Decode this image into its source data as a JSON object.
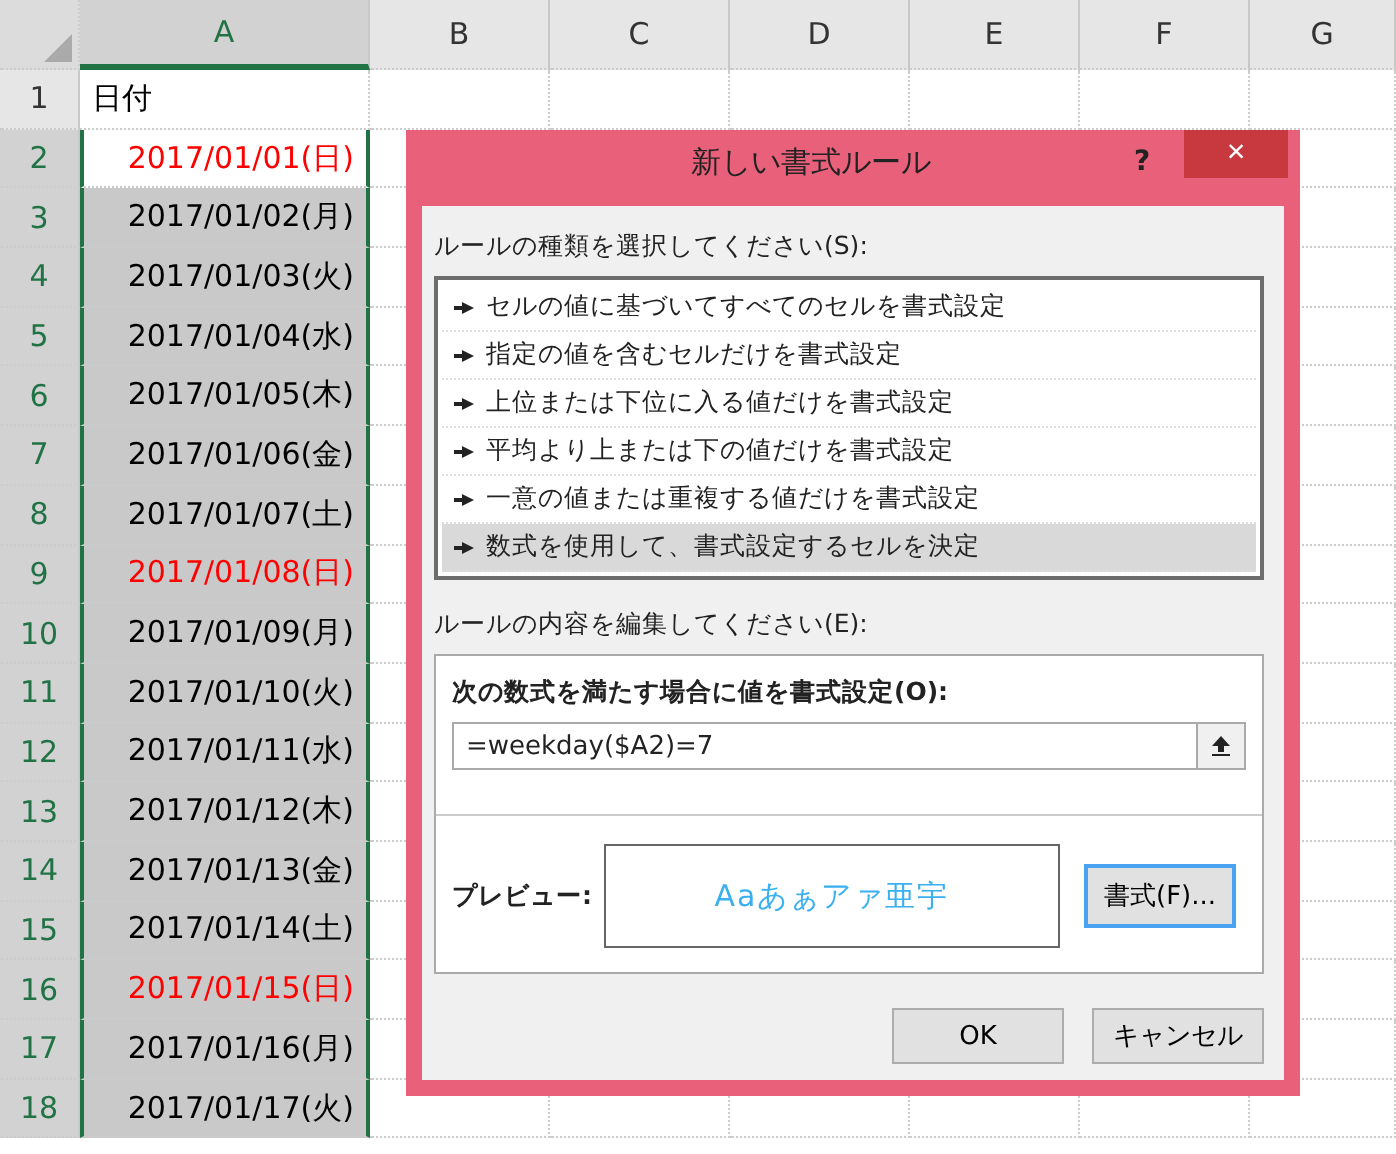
{
  "sheet": {
    "columns": [
      {
        "label": "A",
        "selected": true
      },
      {
        "label": "B",
        "selected": false
      },
      {
        "label": "C",
        "selected": false
      },
      {
        "label": "D",
        "selected": false
      },
      {
        "label": "E",
        "selected": false
      },
      {
        "label": "F",
        "selected": false
      },
      {
        "label": "G",
        "selected": false
      }
    ],
    "header_row": {
      "number": "1",
      "selected": false,
      "value": "日付"
    },
    "rows": [
      {
        "number": "2",
        "selected": true,
        "active": true,
        "value": "2017/01/01(日)",
        "color": "#ff0000"
      },
      {
        "number": "3",
        "selected": true,
        "active": false,
        "value": "2017/01/02(月)",
        "color": "#000000"
      },
      {
        "number": "4",
        "selected": true,
        "active": false,
        "value": "2017/01/03(火)",
        "color": "#000000"
      },
      {
        "number": "5",
        "selected": true,
        "active": false,
        "value": "2017/01/04(水)",
        "color": "#000000"
      },
      {
        "number": "6",
        "selected": true,
        "active": false,
        "value": "2017/01/05(木)",
        "color": "#000000"
      },
      {
        "number": "7",
        "selected": true,
        "active": false,
        "value": "2017/01/06(金)",
        "color": "#000000"
      },
      {
        "number": "8",
        "selected": true,
        "active": false,
        "value": "2017/01/07(土)",
        "color": "#000000"
      },
      {
        "number": "9",
        "selected": true,
        "active": false,
        "value": "2017/01/08(日)",
        "color": "#ff0000"
      },
      {
        "number": "10",
        "selected": true,
        "active": false,
        "value": "2017/01/09(月)",
        "color": "#000000"
      },
      {
        "number": "11",
        "selected": true,
        "active": false,
        "value": "2017/01/10(火)",
        "color": "#000000"
      },
      {
        "number": "12",
        "selected": true,
        "active": false,
        "value": "2017/01/11(水)",
        "color": "#000000"
      },
      {
        "number": "13",
        "selected": true,
        "active": false,
        "value": "2017/01/12(木)",
        "color": "#000000"
      },
      {
        "number": "14",
        "selected": true,
        "active": false,
        "value": "2017/01/13(金)",
        "color": "#000000"
      },
      {
        "number": "15",
        "selected": true,
        "active": false,
        "value": "2017/01/14(土)",
        "color": "#000000"
      },
      {
        "number": "16",
        "selected": true,
        "active": false,
        "value": "2017/01/15(日)",
        "color": "#ff0000"
      },
      {
        "number": "17",
        "selected": true,
        "active": false,
        "value": "2017/01/16(月)",
        "color": "#000000"
      },
      {
        "number": "18",
        "selected": true,
        "active": false,
        "value": "2017/01/17(火)",
        "color": "#000000"
      }
    ]
  },
  "dialog": {
    "title": "新しい書式ルール",
    "help": "?",
    "close": "×",
    "rule_type_label": "ルールの種類を選択してください(S):",
    "rule_types": [
      {
        "label": "セルの値に基づいてすべてのセルを書式設定",
        "selected": false
      },
      {
        "label": "指定の値を含むセルだけを書式設定",
        "selected": false
      },
      {
        "label": "上位または下位に入る値だけを書式設定",
        "selected": false
      },
      {
        "label": "平均より上または下の値だけを書式設定",
        "selected": false
      },
      {
        "label": "一意の値または重複する値だけを書式設定",
        "selected": false
      },
      {
        "label": "数式を使用して、書式設定するセルを決定",
        "selected": true
      }
    ],
    "edit_label": "ルールの内容を編集してください(E):",
    "formula_label": "次の数式を満たす場合に値を書式設定(O):",
    "formula": "=weekday($A2)=7",
    "preview_label": "プレビュー:",
    "preview_text": "Aaあぁアァ亜宇",
    "format_button": "書式(F)...",
    "buttons": [
      "OK",
      "キャンセル"
    ]
  }
}
